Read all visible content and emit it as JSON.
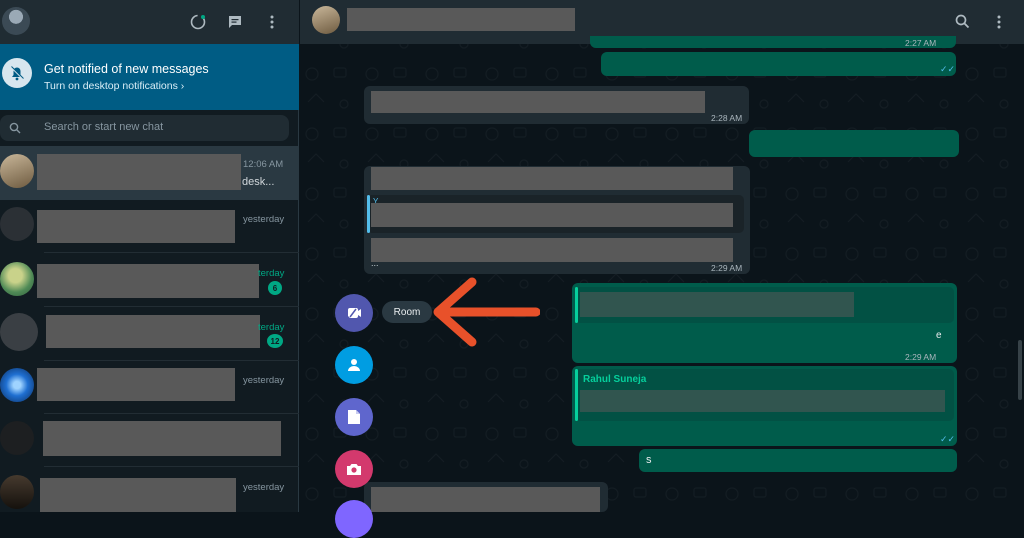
{
  "colors": {
    "accent": "#00a884",
    "notify_bg": "#005c84",
    "arrow": "#e8512a",
    "room": "#5157ae",
    "contact": "#009de2",
    "document": "#5f66cd",
    "camera": "#d3396d",
    "sticker": "#7f66ff"
  },
  "left_header": {
    "icons": [
      "status-icon",
      "new-chat-icon",
      "menu-icon"
    ]
  },
  "notification": {
    "title": "Get notified of new messages",
    "subtitle": "Turn on desktop notifications ›"
  },
  "search": {
    "placeholder": "Search or start new chat"
  },
  "chats": [
    {
      "time": "12:06 AM",
      "preview_tail": "desk...",
      "time_green": false
    },
    {
      "time": "yesterday",
      "time_green": false
    },
    {
      "time": "terday",
      "time_green": true,
      "unread": "6"
    },
    {
      "time": "terday",
      "time_green": true,
      "unread": "12"
    },
    {
      "time": "yesterday",
      "time_green": false
    },
    {
      "time": "",
      "time_green": false
    },
    {
      "time": "yesterday",
      "time_green": false
    }
  ],
  "messages": {
    "top_out_time": "2:27 AM",
    "in1_time": "2:28 AM",
    "in2_time": "2:29 AM",
    "in2_quote_fragment": "Y...",
    "in2_partial_text": "...",
    "out2_time": "2:29 AM",
    "out2_partial_text": "e",
    "quote_author": "Rahul Suneja",
    "out_short": "s"
  },
  "attach_menu": {
    "tooltip": "Room"
  }
}
